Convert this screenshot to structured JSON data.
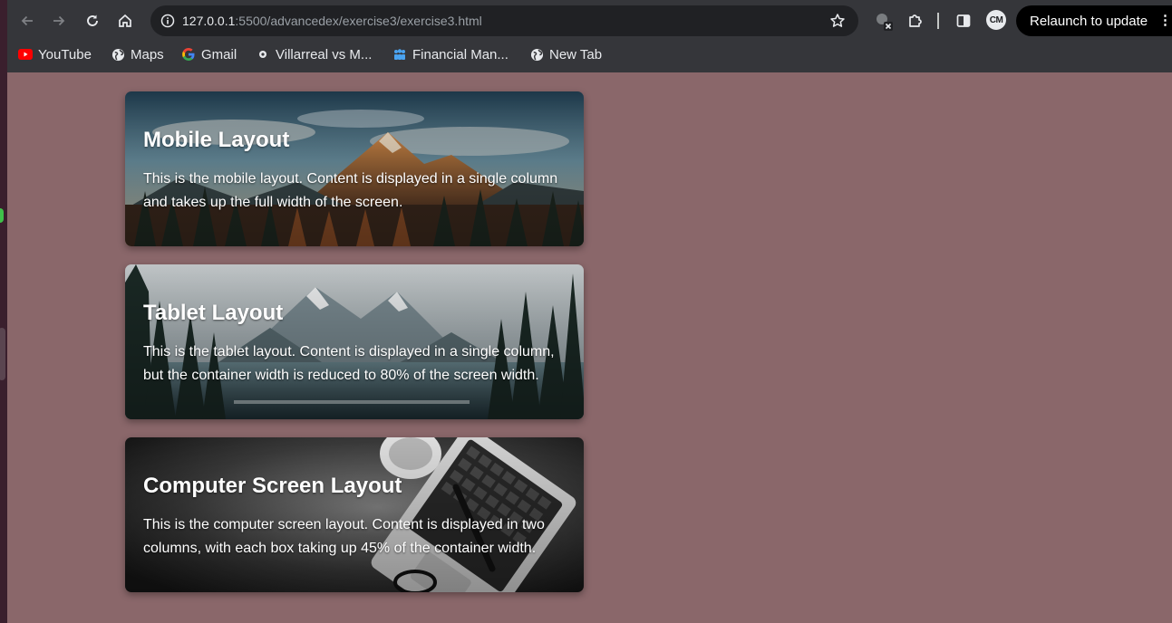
{
  "browser": {
    "url_host": "127.0.0.1",
    "url_path": ":5500/advancedex/exercise3/exercise3.html",
    "profile_initials": "CM",
    "relaunch_label": "Relaunch to update"
  },
  "bookmarks": [
    {
      "label": "YouTube",
      "icon": "youtube-icon"
    },
    {
      "label": "Maps",
      "icon": "globe-icon"
    },
    {
      "label": "Gmail",
      "icon": "google-icon"
    },
    {
      "label": "Villarreal vs M...",
      "icon": "soccer-icon"
    },
    {
      "label": "Financial Man...",
      "icon": "people-icon"
    },
    {
      "label": "New Tab",
      "icon": "globe-icon"
    }
  ],
  "cards": [
    {
      "title": "Mobile Layout",
      "text": "This is the mobile layout. Content is displayed in a single column and takes up the full width of the screen."
    },
    {
      "title": "Tablet Layout",
      "text": "This is the tablet layout. Content is displayed in a single column, but the container width is reduced to 80% of the screen width."
    },
    {
      "title": "Computer Screen Layout",
      "text": "This is the computer screen layout. Content is displayed in two columns, with each box taking up 45% of the container width."
    }
  ],
  "colors": {
    "page_background": "#8a676a",
    "chrome_background": "#35363a",
    "omnibox_background": "#202124"
  }
}
